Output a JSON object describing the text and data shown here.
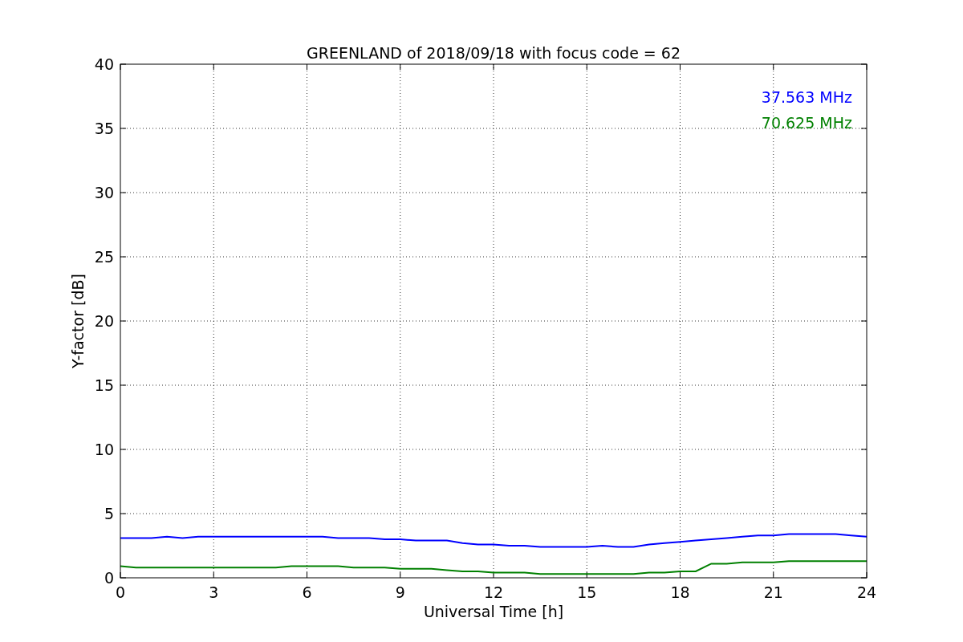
{
  "chart_data": {
    "type": "line",
    "title": "GREENLAND of 2018/09/18 with focus code = 62",
    "xlabel": "Universal Time [h]",
    "ylabel": "Y-factor [dB]",
    "x": [
      0,
      0.5,
      1,
      1.5,
      2,
      2.5,
      3,
      3.5,
      4,
      4.5,
      5,
      5.5,
      6,
      6.5,
      7,
      7.5,
      8,
      8.5,
      9,
      9.5,
      10,
      10.5,
      11,
      11.5,
      12,
      12.5,
      13,
      13.5,
      14,
      14.5,
      15,
      15.5,
      16,
      16.5,
      17,
      17.5,
      18,
      18.5,
      19,
      19.5,
      20,
      20.5,
      21,
      21.5,
      22,
      22.5,
      23,
      23.5,
      24
    ],
    "series": [
      {
        "name": "37.563 MHz",
        "color": "#0000ff",
        "values": [
          3.1,
          3.1,
          3.1,
          3.2,
          3.1,
          3.2,
          3.2,
          3.2,
          3.2,
          3.2,
          3.2,
          3.2,
          3.2,
          3.2,
          3.1,
          3.1,
          3.1,
          3.0,
          3.0,
          2.9,
          2.9,
          2.9,
          2.7,
          2.6,
          2.6,
          2.5,
          2.5,
          2.4,
          2.4,
          2.4,
          2.4,
          2.5,
          2.4,
          2.4,
          2.6,
          2.7,
          2.8,
          2.9,
          3.0,
          3.1,
          3.2,
          3.3,
          3.3,
          3.4,
          3.4,
          3.4,
          3.4,
          3.3,
          3.2
        ]
      },
      {
        "name": "70.625 MHz",
        "color": "#008000",
        "values": [
          0.9,
          0.8,
          0.8,
          0.8,
          0.8,
          0.8,
          0.8,
          0.8,
          0.8,
          0.8,
          0.8,
          0.9,
          0.9,
          0.9,
          0.9,
          0.8,
          0.8,
          0.8,
          0.7,
          0.7,
          0.7,
          0.6,
          0.5,
          0.5,
          0.4,
          0.4,
          0.4,
          0.3,
          0.3,
          0.3,
          0.3,
          0.3,
          0.3,
          0.3,
          0.4,
          0.4,
          0.5,
          0.5,
          1.1,
          1.1,
          1.2,
          1.2,
          1.2,
          1.3,
          1.3,
          1.3,
          1.3,
          1.3,
          1.3
        ]
      }
    ],
    "grid": true,
    "xlim": [
      0,
      24
    ],
    "ylim": [
      0,
      40
    ],
    "xticks": [
      0,
      3,
      6,
      9,
      12,
      15,
      18,
      21,
      24
    ],
    "yticks": [
      0,
      5,
      10,
      15,
      20,
      25,
      30,
      35,
      40
    ]
  }
}
